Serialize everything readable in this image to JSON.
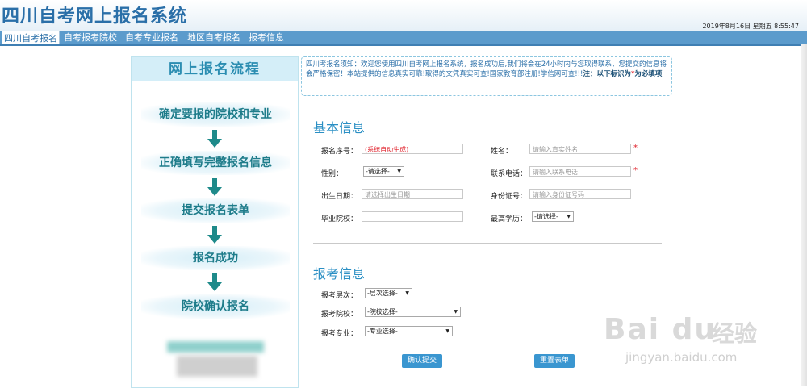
{
  "header": {
    "title": "四川自考网上报名系统",
    "datetime": "2019年8月16日 星期五 8:55:47"
  },
  "nav": {
    "items": [
      "四川自考报名",
      "自考报考院校",
      "自考专业报名",
      "地区自考报名",
      "报考信息"
    ]
  },
  "process": {
    "title": "网上报名流程",
    "steps": [
      "确定要报的院校和专业",
      "正确填写完整报名信息",
      "提交报名表单",
      "报名成功",
      "院校确认报名"
    ]
  },
  "notice": {
    "text": "四川考报名须知：欢迎您使用四川自考网上报名系统，报名成功后,我们将会在24小时内与您取得联系，您提交的信息将会严格保密！本站提供的信息真实可靠!取得的文凭真实可查!国家教育部注册!学信网可查!!!",
    "note_prefix": "注：以下标识为",
    "note_star": "*",
    "note_suffix": "为必填项"
  },
  "basic": {
    "title": "基本信息",
    "serial_label": "报名序号：",
    "serial_value": "(系统自动生成)",
    "name_label": "姓名：",
    "name_placeholder": "请输入真实姓名",
    "gender_label": "性别：",
    "gender_value": "-请选择-",
    "phone_label": "联系电话：",
    "phone_placeholder": "请输入联系电话",
    "birth_label": "出生日期：",
    "birth_placeholder": "请选择出生日期",
    "id_label": "身份证号：",
    "id_placeholder": "请输入身份证号码",
    "school_label": "毕业院校：",
    "edu_label": "最高学历：",
    "edu_value": "-请选择-",
    "required_mark": "*"
  },
  "exam": {
    "title": "报考信息",
    "level_label": "报考层次：",
    "level_value": "-层次选择-",
    "college_label": "报考院校：",
    "college_value": "-院校选择-",
    "major_label": "报考专业：",
    "major_value": "-专业选择-"
  },
  "buttons": {
    "submit": "确认提交",
    "reset": "重置表单"
  },
  "watermark": {
    "logo": "Bai du",
    "cn": "经验",
    "url": "jingyan.baidu.com"
  }
}
